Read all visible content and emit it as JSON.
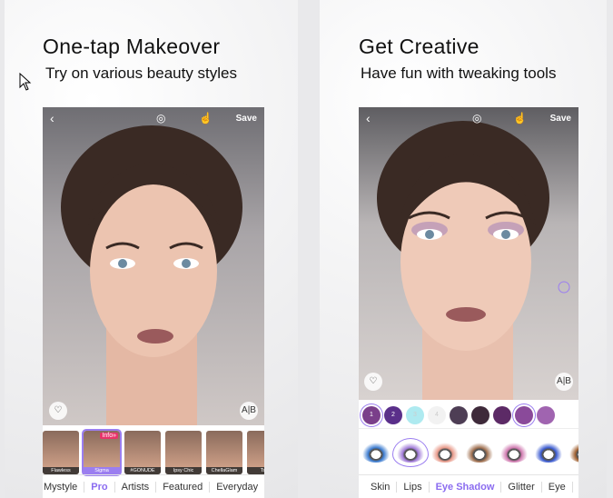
{
  "left": {
    "title": "One-tap Makeover",
    "subtitle": "Try on various beauty styles",
    "save": "Save",
    "ab": "A|B",
    "thumbs": [
      {
        "label": "Flawless"
      },
      {
        "label": "Sigma",
        "badge": "Info»",
        "selected": true
      },
      {
        "label": "#GONUDE"
      },
      {
        "label": "Ipsy Chic"
      },
      {
        "label": "ChellaGlam"
      },
      {
        "label": "Tsur"
      }
    ],
    "tabs": [
      "Mystyle",
      "Pro",
      "Artists",
      "Featured",
      "Everyday"
    ],
    "active_tab": "Pro"
  },
  "right": {
    "title": "Get Creative",
    "subtitle": "Have fun with tweaking tools",
    "save": "Save",
    "ab": "A|B",
    "swatches": [
      {
        "n": "1",
        "c": "#7a3f8a"
      },
      {
        "n": "2",
        "c": "#5a2f8a"
      },
      {
        "n": "3",
        "c": "#aeeaf0"
      },
      {
        "n": "4",
        "c": "#f2f2f2"
      },
      {
        "n": "",
        "c": "#4e3e55"
      },
      {
        "n": "",
        "c": "#3e2a3a"
      },
      {
        "n": "",
        "c": "#5c2a66"
      },
      {
        "n": "",
        "c": "#8a4a9a"
      },
      {
        "n": "",
        "c": "#a064b0"
      }
    ],
    "eyeshadows": [
      "#3b7bd0",
      "#a07ad8",
      "#e89a8a",
      "#a07050",
      "#d07ab0",
      "#3a5ad0",
      "#a06030"
    ],
    "tabs": [
      "Skin",
      "Lips",
      "Eye Shadow",
      "Glitter",
      "Eye"
    ],
    "active_tab": "Eye Shadow"
  },
  "accent": "#8b6cf0"
}
